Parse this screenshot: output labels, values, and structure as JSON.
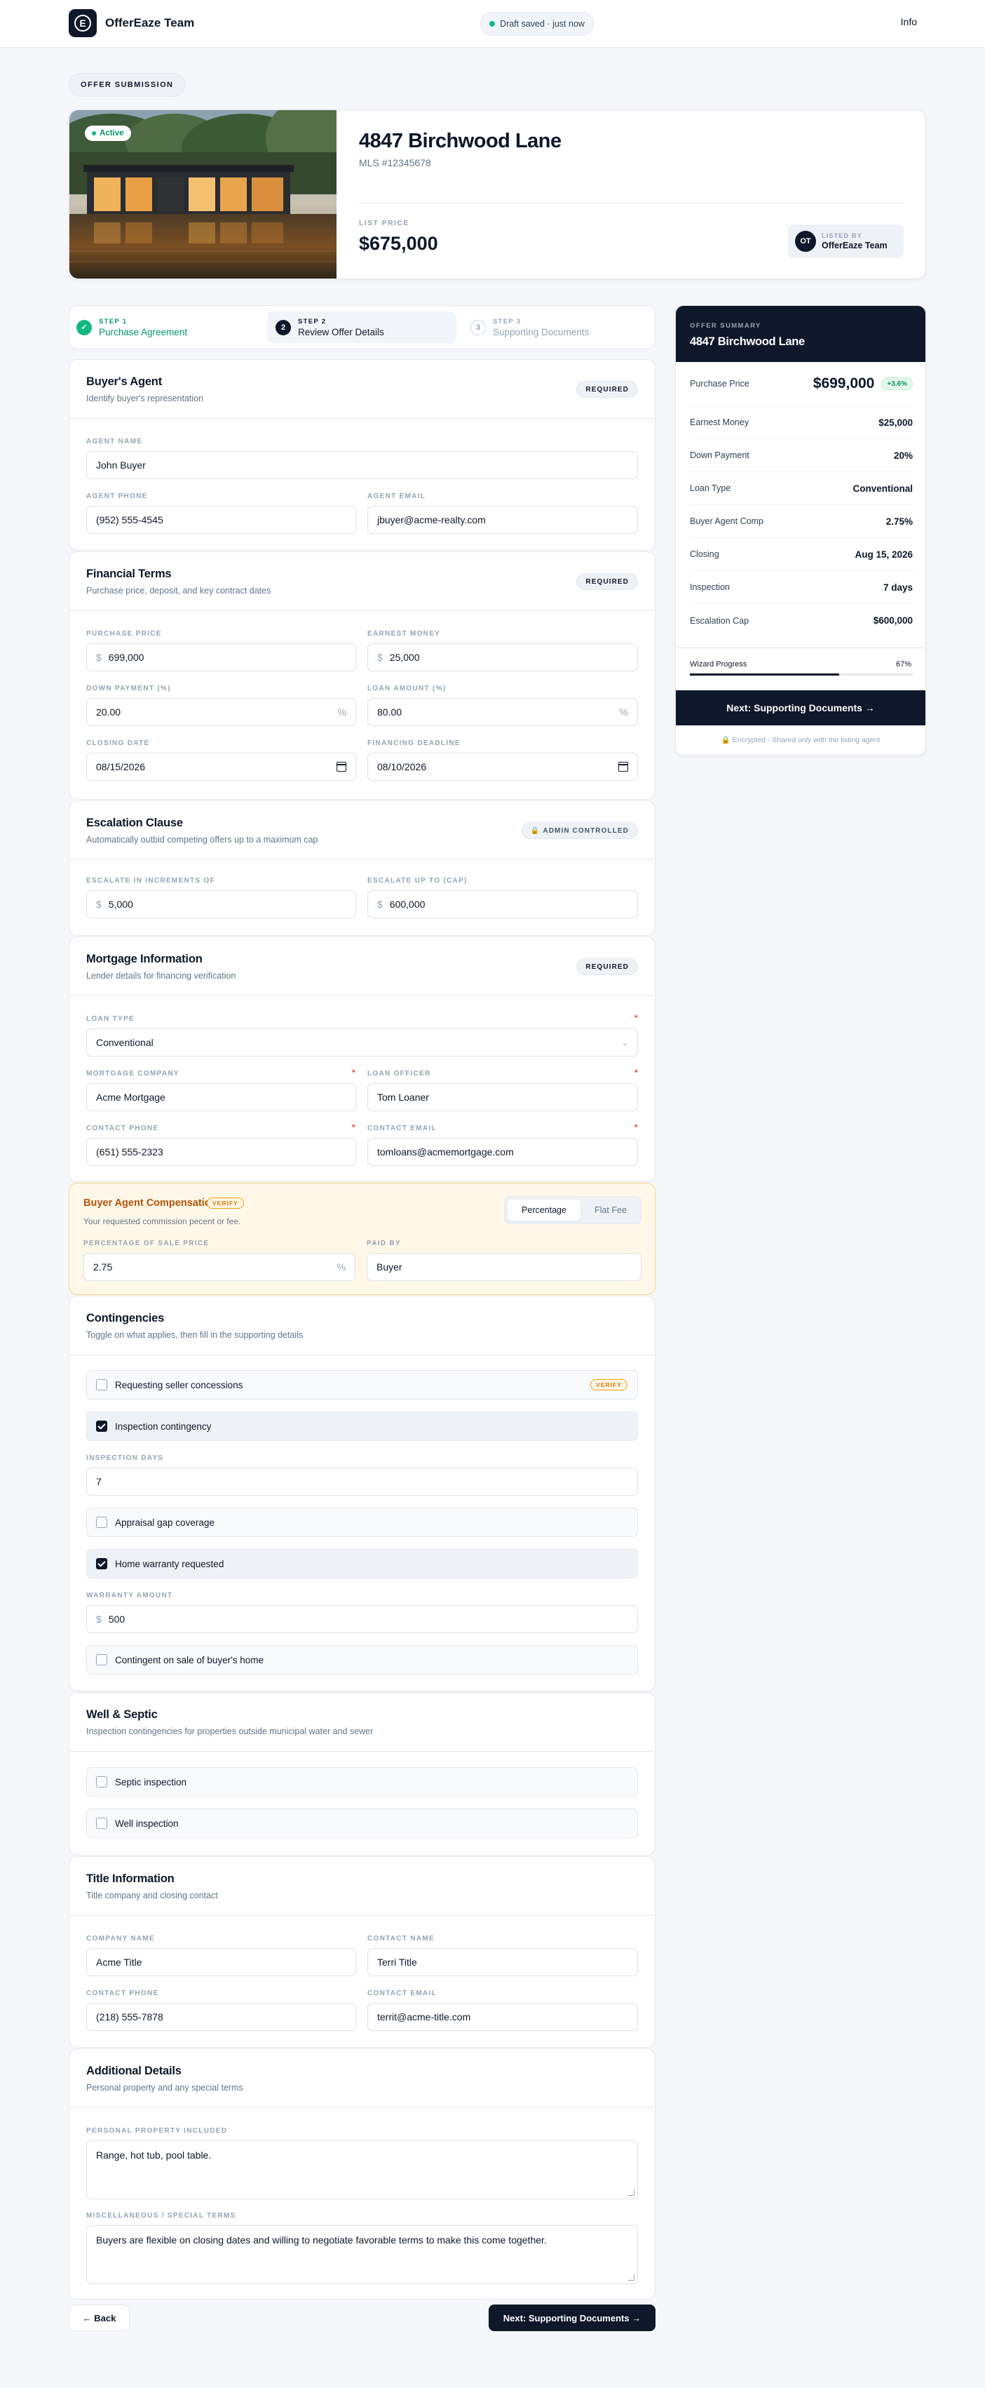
{
  "header": {
    "brand_initial": "E",
    "brand_name": "OfferEaze Team",
    "draft_status": "Draft saved · just now",
    "info_link": "Info"
  },
  "hero": {
    "tag": "OFFER SUBMISSION",
    "status": "Active",
    "address": "4847 Birchwood Lane",
    "mls": "MLS #12345678",
    "list_price_label": "LIST PRICE",
    "list_price": "$675,000",
    "listed_by_label": "LISTED BY",
    "listed_by_initials": "OT",
    "listed_by_name": "OfferEaze Team"
  },
  "steps": [
    {
      "num": "STEP 1",
      "name": "Purchase Agreement",
      "icon": "✓"
    },
    {
      "num": "STEP 2",
      "name": "Review Offer Details",
      "icon": "2"
    },
    {
      "num": "STEP 3",
      "name": "Supporting Documents",
      "icon": "3"
    }
  ],
  "buyers_agent": {
    "title": "Buyer's Agent",
    "subtitle": "Identify buyer's representation",
    "badge": "REQUIRED",
    "name_label": "AGENT NAME",
    "name": "John Buyer",
    "phone_label": "AGENT PHONE",
    "phone": "(952) 555-4545",
    "email_label": "AGENT EMAIL",
    "email": "jbuyer@acme-realty.com"
  },
  "financial": {
    "title": "Financial Terms",
    "subtitle": "Purchase price, deposit, and key contract dates",
    "badge": "REQUIRED",
    "price_label": "PURCHASE PRICE",
    "price": "699,000",
    "earnest_label": "EARNEST MONEY",
    "earnest": "25,000",
    "down_label": "DOWN PAYMENT (%)",
    "down": "20.00",
    "loan_label": "LOAN AMOUNT (%)",
    "loan": "80.00",
    "closing_label": "CLOSING DATE",
    "closing": "08/15/2026",
    "financing_label": "FINANCING DEADLINE",
    "financing": "08/10/2026",
    "currency": "$",
    "percent": "%"
  },
  "escalation": {
    "title": "Escalation Clause",
    "subtitle": "Automatically outbid competing offers up to a maximum cap",
    "badge": "ADMIN CONTROLLED",
    "increment_label": "ESCALATE IN INCREMENTS OF",
    "increment": "5,000",
    "cap_label": "ESCALATE UP TO (CAP)",
    "cap": "600,000"
  },
  "mortgage": {
    "title": "Mortgage Information",
    "subtitle": "Lender details for financing verification",
    "badge": "REQUIRED",
    "loan_type_label": "LOAN TYPE",
    "loan_type": "Conventional",
    "company_label": "MORTGAGE COMPANY",
    "company": "Acme Mortgage",
    "officer_label": "LOAN OFFICER",
    "officer": "Tom Loaner",
    "phone_label": "CONTACT PHONE",
    "phone": "(651) 555-2323",
    "email_label": "CONTACT EMAIL",
    "email": "tomloans@acmemortgage.com",
    "required_mark": "*"
  },
  "compensation": {
    "title": "Buyer Agent Compensation",
    "verify": "VERIFY",
    "subtitle": "Your requested commission pecent or fee.",
    "opt_percentage": "Percentage",
    "opt_flat": "Flat Fee",
    "pct_label": "PERCENTAGE OF SALE PRICE",
    "pct": "2.75",
    "paid_by_label": "PAID BY",
    "paid_by": "Buyer"
  },
  "contingencies": {
    "title": "Contingencies",
    "subtitle": "Toggle on what applies, then fill in the supporting details",
    "seller_concessions": "Requesting seller concessions",
    "verify": "VERIFY",
    "inspection": "Inspection contingency",
    "inspection_days_label": "INSPECTION DAYS",
    "inspection_days": "7",
    "appraisal": "Appraisal gap coverage",
    "warranty": "Home warranty requested",
    "warranty_amount_label": "WARRANTY AMOUNT",
    "warranty_amount": "500",
    "sale_of_home": "Contingent on sale of buyer's home"
  },
  "well_septic": {
    "title": "Well & Septic",
    "subtitle": "Inspection contingencies for properties outside municipal water and sewer",
    "septic": "Septic inspection",
    "well": "Well inspection"
  },
  "title_info": {
    "title": "Title Information",
    "subtitle": "Title company and closing contact",
    "company_label": "COMPANY NAME",
    "company": "Acme Title",
    "contact_label": "CONTACT NAME",
    "contact": "Terri Title",
    "phone_label": "CONTACT PHONE",
    "phone": "(218) 555-7878",
    "email_label": "CONTACT EMAIL",
    "email": "territ@acme-title.com"
  },
  "additional": {
    "title": "Additional Details",
    "subtitle": "Personal property and any special terms",
    "property_label": "PERSONAL PROPERTY INCLUDED",
    "property": "Range, hot tub, pool table.",
    "misc_label": "MISCELLANEOUS / SPECIAL TERMS",
    "misc": "Buyers are flexible on closing dates and willing to negotiate favorable terms to make this come together."
  },
  "nav": {
    "back": "← Back",
    "next": "Next: Supporting Documents →"
  },
  "summary": {
    "label": "OFFER SUMMARY",
    "address": "4847 Birchwood Lane",
    "rows": [
      {
        "k": "Purchase Price",
        "v": "$699,000",
        "badge": "+3.6%"
      },
      {
        "k": "Earnest Money",
        "v": "$25,000"
      },
      {
        "k": "Down Payment",
        "v": "20%"
      },
      {
        "k": "Loan Type",
        "v": "Conventional"
      },
      {
        "k": "Buyer Agent Comp",
        "v": "2.75%"
      },
      {
        "k": "Closing",
        "v": "Aug 15, 2026"
      },
      {
        "k": "Inspection",
        "v": "7 days"
      },
      {
        "k": "Escalation Cap",
        "v": "$600,000"
      }
    ],
    "progress_label": "Wizard Progress",
    "progress_text": "67%",
    "progress_value": 0.67,
    "button": "Next: Supporting Documents →",
    "footer": "Encrypted · Shared only with the listing agent"
  },
  "colors": {
    "primary": "#0f172a",
    "success": "#10b981",
    "warning": "#d97706",
    "warning_bg": "#fff8e8"
  }
}
